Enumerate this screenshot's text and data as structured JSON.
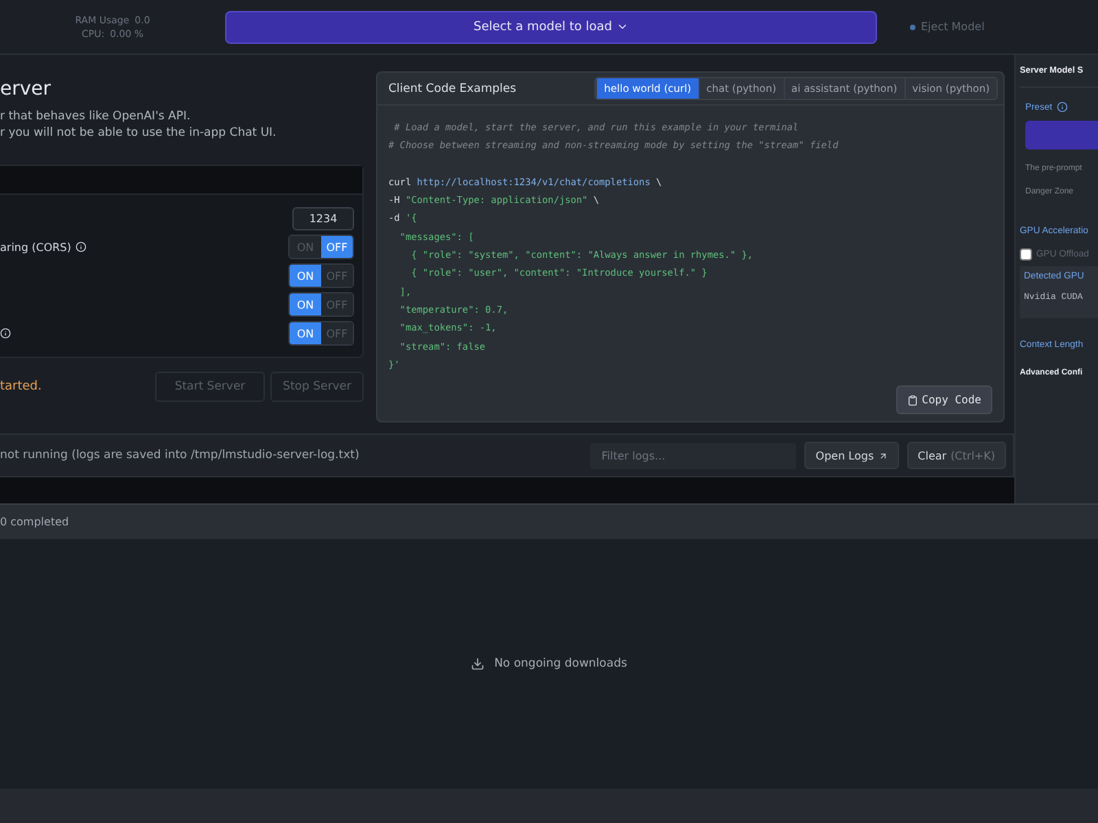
{
  "top_bar": {
    "ram_label": "RAM Usage",
    "ram_value": "0.0",
    "cpu_label": "CPU:",
    "cpu_value": "0.00 %",
    "model_select": "Select a model to load",
    "eject": "Eject Model"
  },
  "server_panel": {
    "title": "erver",
    "description": [
      "r that behaves like OpenAI's API.",
      "r you will not be able to use the in-app Chat UI."
    ],
    "settings": [
      {
        "kind": "port",
        "value": "1234"
      },
      {
        "kind": "toggle",
        "label": "aring (CORS)",
        "info": true,
        "on": false,
        "on_label": "ON",
        "off_label": "OFF"
      },
      {
        "kind": "toggle",
        "on": true,
        "on_label": "ON",
        "off_label": "OFF"
      },
      {
        "kind": "toggle",
        "on": true,
        "on_label": "ON",
        "off_label": "OFF"
      },
      {
        "kind": "toggle",
        "info": true,
        "on": true,
        "on_label": "ON",
        "off_label": "OFF"
      }
    ],
    "status": "tarted.",
    "start_button": "Start Server",
    "stop_button": "Stop Server"
  },
  "code_panel": {
    "title": "Client Code Examples",
    "tabs": [
      {
        "label": "hello world (curl)",
        "selected": true
      },
      {
        "label": "chat (python)",
        "selected": false
      },
      {
        "label": "ai assistant (python)",
        "selected": false
      },
      {
        "label": "vision (python)",
        "selected": false
      }
    ],
    "lines": [
      {
        "segments": [
          {
            "kind": "comment",
            "text": " # Load a model, start the server, and run this example in your terminal"
          }
        ]
      },
      {
        "segments": [
          {
            "kind": "comment",
            "text": "# Choose between streaming and non-streaming mode by setting the \"stream\" field"
          }
        ]
      },
      {
        "gap_before": true,
        "segments": [
          {
            "kind": "plain",
            "text": "curl "
          },
          {
            "kind": "url",
            "text": "http://localhost:1234/v1/chat/completions"
          },
          {
            "kind": "plain",
            "text": " \\"
          }
        ]
      },
      {
        "segments": [
          {
            "kind": "plain",
            "text": "-H "
          },
          {
            "kind": "string",
            "text": "\"Content-Type: application/json\""
          },
          {
            "kind": "plain",
            "text": " \\"
          }
        ]
      },
      {
        "segments": [
          {
            "kind": "plain",
            "text": "-d "
          },
          {
            "kind": "string",
            "text": "'{"
          }
        ]
      },
      {
        "segments": [
          {
            "kind": "string",
            "text": "  \"messages\": ["
          }
        ]
      },
      {
        "segments": [
          {
            "kind": "string",
            "text": "    { \"role\": \"system\", \"content\": \"Always answer in rhymes.\" },"
          }
        ]
      },
      {
        "segments": [
          {
            "kind": "string",
            "text": "    { \"role\": \"user\", \"content\": \"Introduce yourself.\" }"
          }
        ]
      },
      {
        "segments": [
          {
            "kind": "string",
            "text": "  ],"
          }
        ]
      },
      {
        "segments": [
          {
            "kind": "string",
            "text": "  \"temperature\": 0.7,"
          }
        ]
      },
      {
        "segments": [
          {
            "kind": "string",
            "text": "  \"max_tokens\": -1,"
          }
        ]
      },
      {
        "segments": [
          {
            "kind": "string",
            "text": "  \"stream\": false"
          }
        ]
      },
      {
        "segments": [
          {
            "kind": "string",
            "text": "}'"
          }
        ]
      }
    ],
    "copy_button": "Copy Code"
  },
  "log_bar": {
    "status": "not running (logs are saved into /tmp/lmstudio-server-log.txt)",
    "filter_placeholder": "Filter logs...",
    "open_logs": "Open Logs",
    "clear": "Clear",
    "clear_shortcut": "(Ctrl+K)"
  },
  "sidebar": {
    "title": "Server Model S",
    "preset_label": "Preset",
    "pre_prompt": "The pre-prompt",
    "danger_zone": "Danger Zone",
    "gpu_heading": "GPU Acceleratio",
    "gpu_offload": {
      "label": "GPU Offload",
      "checked": false
    },
    "detected_gpu_label": "Detected GPU",
    "detected_gpu_value": "Nvidia CUDA",
    "context_length": "Context Length",
    "advanced": "Advanced Confi"
  },
  "downloads": {
    "summary": "0 completed",
    "empty": "No ongoing downloads"
  }
}
